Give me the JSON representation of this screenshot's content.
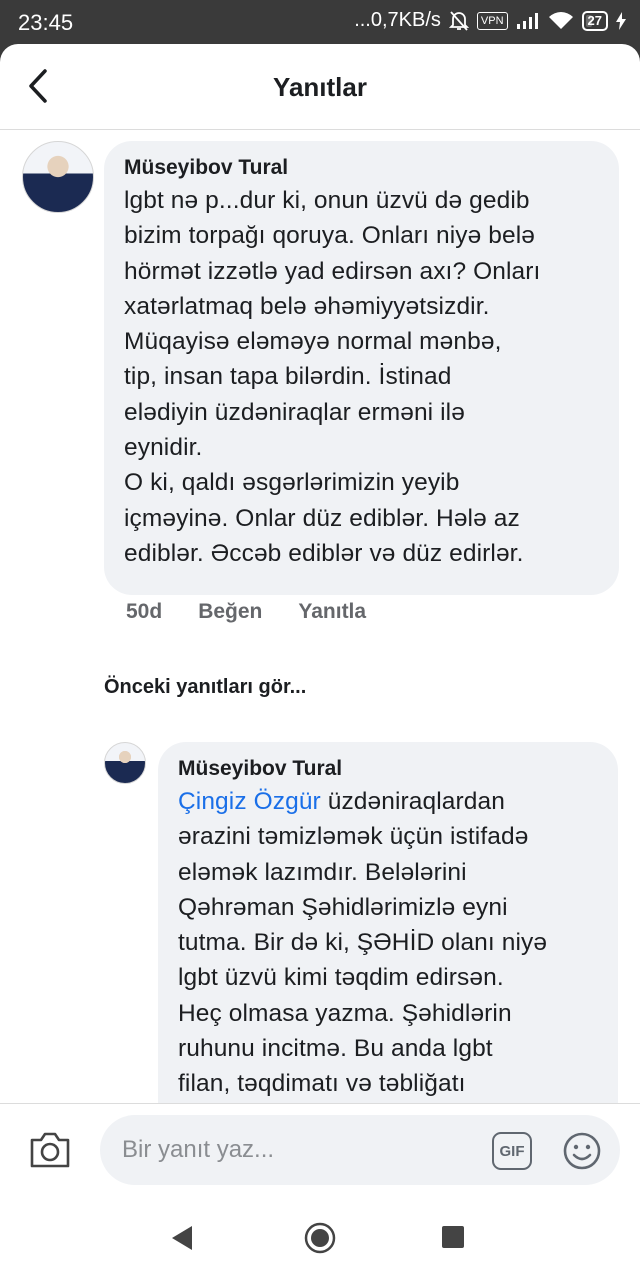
{
  "status_bar": {
    "time": "23:45",
    "network_speed": "...0,7KB/s",
    "vpn": "VPN",
    "battery": "27"
  },
  "header": {
    "title": "Yanıtlar"
  },
  "comment": {
    "author": "Müseyibov Tural",
    "text": "lgbt nə p...dur ki, onun üzvü də gedib\nbizim torpağı qoruya. Onları niyə belə\nhörmət izzətlə yad edirsən axı? Onları\nxatərlatmaq belə əhəmiyyətsizdir.\nMüqayisə eləməyə normal mənbə,\ntip, insan tapa bilərdin. İstinad\nelədiyin üzdəniraqlar erməni ilə\neynidir.\nO ki, qaldı əsgərlərimizin yeyib\niçməyinə. Onlar düz ediblər. Hələ az\nediblər. Əccəb ediblər və düz edirlər.",
    "time": "50d",
    "like_label": "Beğen",
    "reply_label": "Yanıtla"
  },
  "previous_replies_label": "Önceki yanıtları gör...",
  "reply": {
    "author": "Müseyibov Tural",
    "mention": "Çingiz Özgür",
    "text": " üzdəniraqlardan\nərazini təmizləmək üçün istifadə\neləmək lazımdır. Belələrini\nQəhrəman Şəhidlərimizlə eyni\ntutma. Bir də ki, ŞƏHİD olanı niyə\nlgbt üzvü kimi təqdim edirsən.\nHeç olmasa yazma. Şəhidlərin\nruhunu incitmə. Bu anda lgbt\nfilan, təqdimatı və təbliğatı"
  },
  "composer": {
    "placeholder": "Bir yanıt yaz...",
    "gif_label": "GIF"
  },
  "colors": {
    "bubble": "#f0f2f5",
    "mention": "#1a6fe8",
    "meta_text": "#65676b",
    "status_bar": "#3a3a3a"
  }
}
